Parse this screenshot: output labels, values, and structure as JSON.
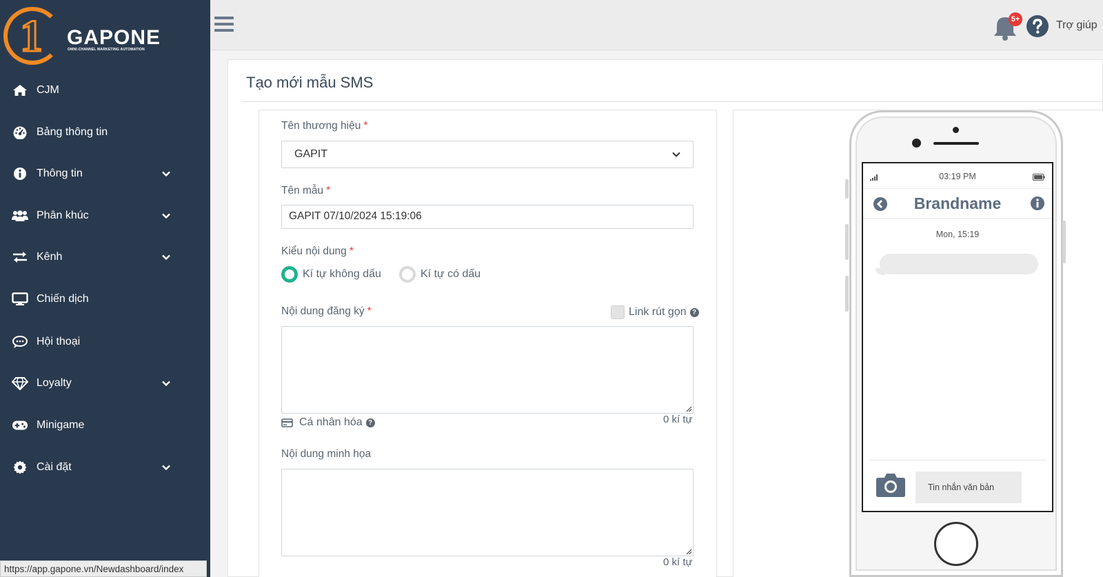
{
  "sidebar": {
    "logo": {
      "brand": "GAPONE",
      "tagline": "OMNI-CHANNEL MARKETING AUTOMATION",
      "mark": "1"
    },
    "items": [
      {
        "label": "CJM",
        "icon": "home-icon",
        "has_submenu": false
      },
      {
        "label": "Bảng thông tin",
        "icon": "dashboard-gauge-icon",
        "has_submenu": false
      },
      {
        "label": "Thông tin",
        "icon": "info-circle-icon",
        "has_submenu": true
      },
      {
        "label": "Phân khúc",
        "icon": "users-icon",
        "has_submenu": true
      },
      {
        "label": "Kênh",
        "icon": "exchange-arrows-icon",
        "has_submenu": true
      },
      {
        "label": "Chiến dịch",
        "icon": "monitor-icon",
        "has_submenu": false
      },
      {
        "label": "Hội thoại",
        "icon": "chat-bubble-icon",
        "has_submenu": false
      },
      {
        "label": "Loyalty",
        "icon": "diamond-icon",
        "has_submenu": true
      },
      {
        "label": "Minigame",
        "icon": "gamepad-icon",
        "has_submenu": false
      },
      {
        "label": "Cài đặt",
        "icon": "gear-icon",
        "has_submenu": true
      }
    ]
  },
  "status_url": "https://app.gapone.vn/Newdashboard/index",
  "topbar": {
    "notification_badge": "5+",
    "help_label": "Trợ giúp"
  },
  "page": {
    "title": "Tạo mới mẫu SMS"
  },
  "form": {
    "brand": {
      "label": "Tên thương hiệu",
      "required_mark": "*",
      "value": "GAPIT"
    },
    "template_name": {
      "label": "Tên mẫu",
      "required_mark": "*",
      "value": "GAPIT 07/10/2024 15:19:06"
    },
    "content_type": {
      "label": "Kiểu nội dung",
      "required_mark": "*",
      "options": [
        "Kí tự không dấu",
        "Kí tự có dấu"
      ],
      "selected": "Kí tự không dấu"
    },
    "register_content": {
      "label": "Nội dung đăng ký",
      "required_mark": "*",
      "value": "",
      "counter": "0 kí tự"
    },
    "short_link": {
      "label": "Link rút gọn",
      "checked": false,
      "help_glyph": "?"
    },
    "personalize": {
      "label": "Cá nhân hóa",
      "help_glyph": "?"
    },
    "sample_content": {
      "label": "Nội dung minh họa",
      "value": "",
      "counter": "0 kí tự"
    }
  },
  "preview": {
    "time": "03:19 PM",
    "contact": "Brandname",
    "date_stamp": "Mon, 15:19",
    "message_text": "",
    "input_placeholder": "Tin nhắn văn bản"
  },
  "colors": {
    "sidebar_bg": "#2a3a4e",
    "logo_orange": "#f08a24",
    "radio_active": "#1fb38f",
    "badge_red": "#e53935",
    "brandname_text": "#5d6d80"
  }
}
